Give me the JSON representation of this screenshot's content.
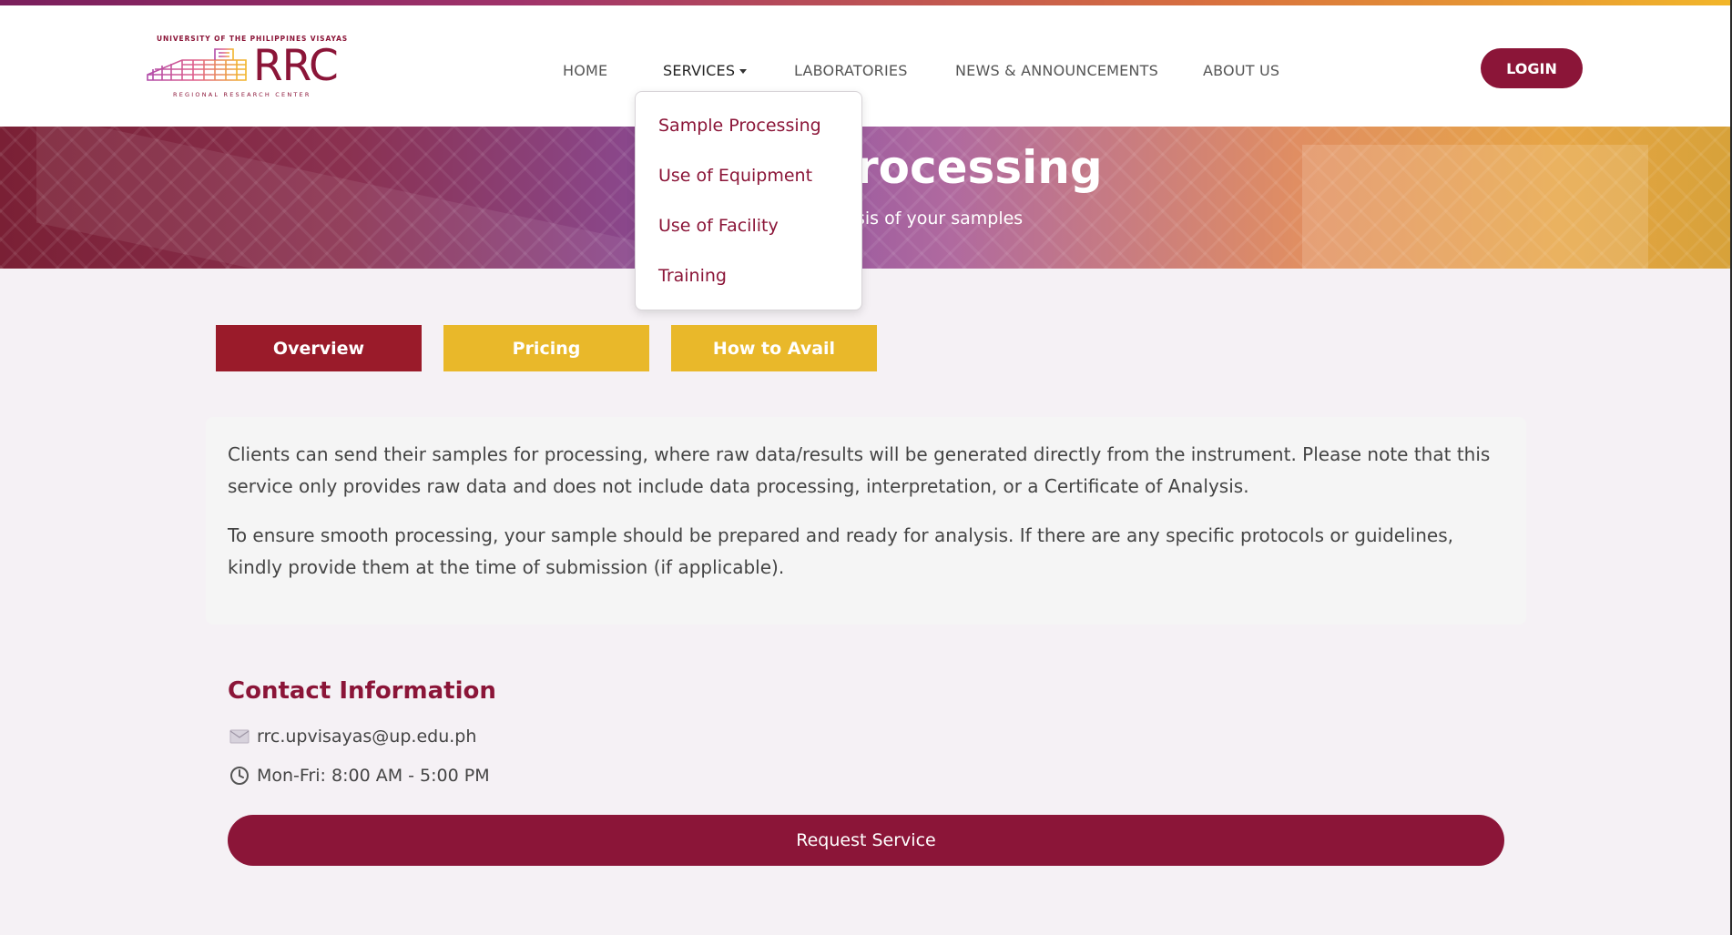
{
  "brand": {
    "university": "UNIVERSITY OF THE PHILIPPINES VISAYAS",
    "name": "RRC",
    "full_name": "REGIONAL RESEARCH CENTER",
    "color": "#8b1538"
  },
  "nav": {
    "home": "HOME",
    "services": "SERVICES",
    "laboratories": "LABORATORIES",
    "news": "NEWS & ANNOUNCEMENTS",
    "about": "ABOUT US",
    "login": "LOGIN"
  },
  "services_menu": {
    "items": [
      "Sample Processing",
      "Use of Equipment",
      "Use of Facility",
      "Training"
    ]
  },
  "hero": {
    "title_visible": "rocessing",
    "subtitle_visible": "sis of your samples"
  },
  "tabs": {
    "overview": "Overview",
    "pricing": "Pricing",
    "how_to_avail": "How to Avail",
    "active": "Overview"
  },
  "overview": {
    "p1": "Clients can send their samples for processing, where raw data/results will be generated directly from the instrument. Please note that this service only provides raw data and does not include data processing, interpretation, or a Certificate of Analysis.",
    "p2": "To ensure smooth processing, your sample should be prepared and ready for analysis. If there are any specific protocols or guidelines, kindly provide them at the time of submission (if applicable)."
  },
  "contact": {
    "title": "Contact Information",
    "email": "rrc.upvisayas@up.edu.ph",
    "hours": "Mon-Fri: 8:00 AM - 5:00 PM"
  },
  "cta": {
    "request": "Request Service"
  },
  "colors": {
    "primary": "#8b1538",
    "tab_active": "#9a1b2a",
    "tab_inactive": "#e9b82a",
    "background": "#f5f1f5"
  }
}
